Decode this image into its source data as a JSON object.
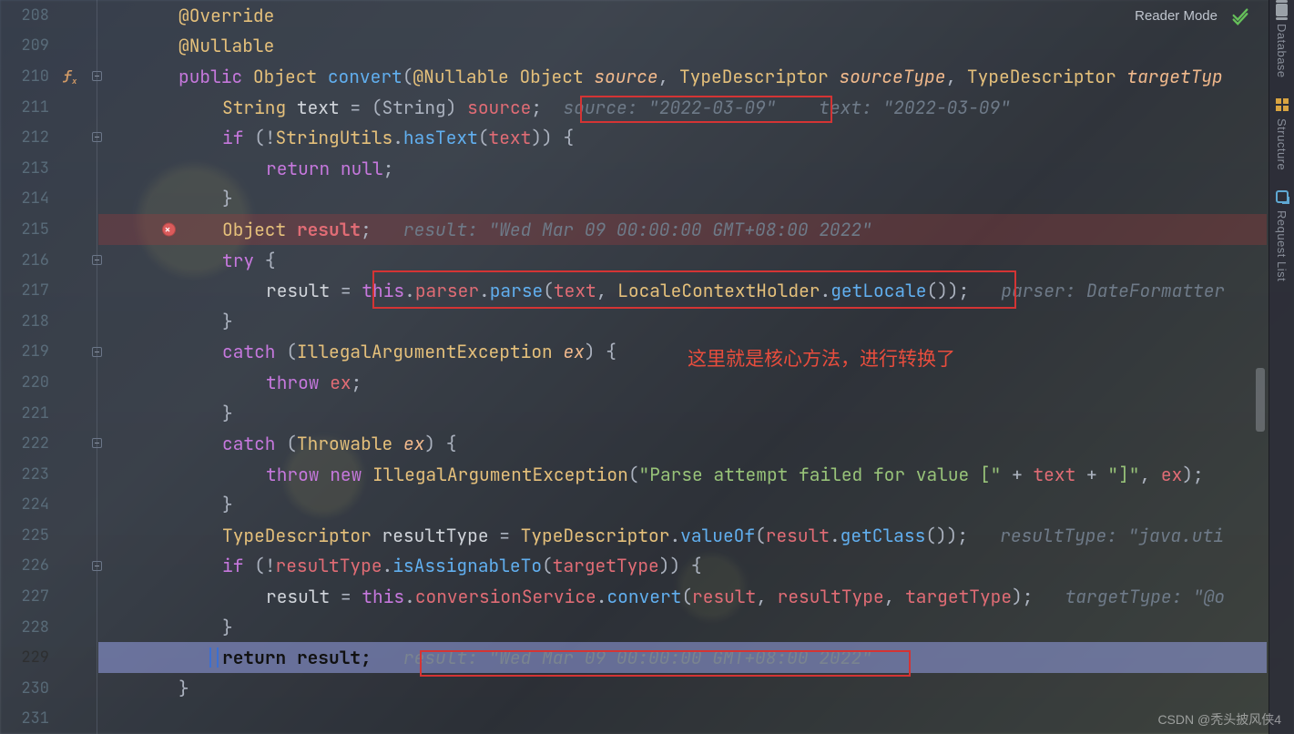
{
  "reader_mode_label": "Reader Mode",
  "right_rail": {
    "database": "Database",
    "structure": "Structure",
    "request": "Request List"
  },
  "annotation": "这里就是核心方法，进行转换了",
  "watermark": "CSDN @秃头披风侠4",
  "lines": {
    "208": {
      "indent": 2
    },
    "209": {
      "indent": 2
    },
    "210": {
      "indent": 2
    },
    "211": {
      "indent": 3,
      "hint_source": "source: \"2022-03-09\"",
      "hint_text": "text: \"2022-03-09\""
    },
    "212": {
      "indent": 3
    },
    "213": {
      "indent": 4
    },
    "214": {
      "indent": 3
    },
    "215": {
      "indent": 3,
      "hint_result": "result: \"Wed Mar 09 00:00:00 GMT+08:00 2022\""
    },
    "216": {
      "indent": 3
    },
    "217": {
      "indent": 4,
      "hint_parser": "parser: DateFormatter"
    },
    "218": {
      "indent": 3
    },
    "219": {
      "indent": 3
    },
    "220": {
      "indent": 4
    },
    "221": {
      "indent": 3
    },
    "222": {
      "indent": 3
    },
    "223": {
      "indent": 4
    },
    "224": {
      "indent": 3
    },
    "225": {
      "indent": 3,
      "hint_rtype": "resultType: \"java.uti"
    },
    "226": {
      "indent": 3
    },
    "227": {
      "indent": 4,
      "hint_target": "targetType: \"@o"
    },
    "228": {
      "indent": 3
    },
    "229": {
      "indent": 3,
      "hint_result": "result: \"Wed Mar 09 00:00:00 GMT+08:00 2022\""
    },
    "230": {
      "indent": 2
    },
    "231": {
      "indent": 0
    }
  },
  "tokens": {
    "override": "@Override",
    "nullable": "@Nullable",
    "public": "public",
    "Object": "Object",
    "convert": "convert",
    "atNullable": "@Nullable",
    "source": "source",
    "TypeDescriptor": "TypeDescriptor",
    "sourceType": "sourceType",
    "targetType": "targetTyp",
    "String": "String",
    "text": "text",
    "castString": "(String)",
    "if": "if",
    "not": "!",
    "StringUtils": "StringUtils",
    "hasText": "hasText",
    "return": "return",
    "null": "null",
    "result": "result",
    "try": "try",
    "this": "this",
    "parser": "parser",
    "parse": "parse",
    "LocaleContextHolder": "LocaleContextHolder",
    "getLocale": "getLocale",
    "catch": "catch",
    "IllegalArgumentException": "IllegalArgumentException",
    "ex": "ex",
    "throw": "throw",
    "Throwable": "Throwable",
    "new": "new",
    "parseFail": "\"Parse attempt failed for value [\"",
    "closeBracket": "\"]\"",
    "resultType": "resultType",
    "valueOf": "valueOf",
    "getClass": "getClass",
    "isAssignableTo": "isAssignableTo",
    "conversionService": "conversionService",
    "targetTypeFull": "targetType"
  }
}
